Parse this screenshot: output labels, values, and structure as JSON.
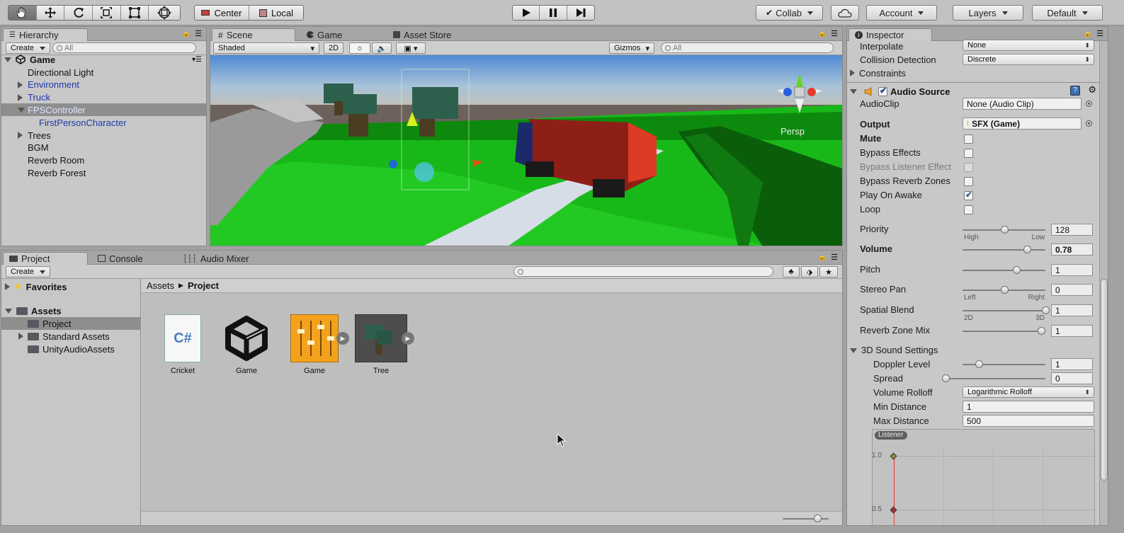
{
  "toolbar": {
    "center_label": "Center",
    "local_label": "Local",
    "collab_label": "Collab",
    "account_label": "Account",
    "layers_label": "Layers",
    "layout_label": "Default"
  },
  "hierarchy": {
    "tab": "Hierarchy",
    "create": "Create",
    "search_placeholder": "All",
    "scene": "Game",
    "items": [
      {
        "label": "Directional Light",
        "indent": 1,
        "expand": "",
        "style": "normal"
      },
      {
        "label": "Environment",
        "indent": 1,
        "expand": "collapsed",
        "style": "prefab"
      },
      {
        "label": "Truck",
        "indent": 1,
        "expand": "collapsed",
        "style": "prefab"
      },
      {
        "label": "FPSController",
        "indent": 1,
        "expand": "expanded",
        "style": "selected"
      },
      {
        "label": "FirstPersonCharacter",
        "indent": 2,
        "expand": "",
        "style": "prefab"
      },
      {
        "label": "Trees",
        "indent": 1,
        "expand": "collapsed",
        "style": "normal"
      },
      {
        "label": "BGM",
        "indent": 1,
        "expand": "",
        "style": "normal"
      },
      {
        "label": "Reverb Room",
        "indent": 1,
        "expand": "",
        "style": "normal"
      },
      {
        "label": "Reverb Forest",
        "indent": 1,
        "expand": "",
        "style": "normal"
      }
    ]
  },
  "scene_view": {
    "tabs": [
      "Scene",
      "Game",
      "Asset Store"
    ],
    "shading": "Shaded",
    "mode_2d": "2D",
    "gizmos": "Gizmos",
    "search_placeholder": "All",
    "persp": "Persp"
  },
  "project": {
    "tabs": [
      "Project",
      "Console",
      "Audio Mixer"
    ],
    "create": "Create",
    "tree": [
      {
        "label": "Favorites",
        "kind": "favorites",
        "indent": 0
      },
      {
        "label": "Assets",
        "kind": "folder-root",
        "indent": 0
      },
      {
        "label": "Project",
        "kind": "folder-selected",
        "indent": 1
      },
      {
        "label": "Standard Assets",
        "kind": "folder-collapsed",
        "indent": 1
      },
      {
        "label": "UnityAudioAssets",
        "kind": "folder",
        "indent": 1
      }
    ],
    "breadcrumb_root": "Assets",
    "breadcrumb_current": "Project",
    "assets": [
      {
        "label": "Cricket",
        "kind": "csharp-script",
        "icon_text": "C#"
      },
      {
        "label": "Game",
        "kind": "unity-scene"
      },
      {
        "label": "Game",
        "kind": "audio-mixer"
      },
      {
        "label": "Tree",
        "kind": "prefab"
      }
    ]
  },
  "inspector": {
    "tab": "Inspector",
    "interpolate": {
      "label": "Interpolate",
      "value": "None"
    },
    "collision": {
      "label": "Collision Detection",
      "value": "Discrete"
    },
    "constraints": "Constraints",
    "component": "Audio Source",
    "audioclip": {
      "label": "AudioClip",
      "value": "None (Audio Clip)"
    },
    "output": {
      "label": "Output",
      "value": "SFX (Game)"
    },
    "checks": [
      {
        "label": "Mute",
        "checked": false,
        "bold": true,
        "disabled": false
      },
      {
        "label": "Bypass Effects",
        "checked": false,
        "bold": false,
        "disabled": false
      },
      {
        "label": "Bypass Listener Effect",
        "checked": false,
        "bold": false,
        "disabled": true
      },
      {
        "label": "Bypass Reverb Zones",
        "checked": false,
        "bold": false,
        "disabled": false
      },
      {
        "label": "Play On Awake",
        "checked": true,
        "bold": false,
        "disabled": false
      },
      {
        "label": "Loop",
        "checked": false,
        "bold": false,
        "disabled": false
      }
    ],
    "sliders": [
      {
        "label": "Priority",
        "value": "128",
        "fraction": 0.5,
        "bold": false,
        "left": "High",
        "right": "Low"
      },
      {
        "label": "Volume",
        "value": "0.78",
        "fraction": 0.78,
        "bold": true,
        "left": "",
        "right": ""
      },
      {
        "label": "Pitch",
        "value": "1",
        "fraction": 0.65,
        "bold": false,
        "left": "",
        "right": ""
      },
      {
        "label": "Stereo Pan",
        "value": "0",
        "fraction": 0.5,
        "bold": false,
        "left": "Left",
        "right": "Right"
      },
      {
        "label": "Spatial Blend",
        "value": "1",
        "fraction": 1.0,
        "bold": false,
        "left": "2D",
        "right": "3D"
      },
      {
        "label": "Reverb Zone Mix",
        "value": "1",
        "fraction": 0.95,
        "bold": false,
        "left": "",
        "right": ""
      }
    ],
    "sound3d": "3D Sound Settings",
    "doppler": {
      "label": "Doppler Level",
      "value": "1",
      "fraction": 0.2
    },
    "spread": {
      "label": "Spread",
      "value": "0",
      "fraction": 0.0
    },
    "rolloff": {
      "label": "Volume Rolloff",
      "value": "Logarithmic Rolloff"
    },
    "min_distance": {
      "label": "Min Distance",
      "value": "1"
    },
    "max_distance": {
      "label": "Max Distance",
      "value": "500"
    },
    "graph": {
      "listener": "Listener",
      "y_top": "1.0",
      "y_mid": "0.5"
    }
  },
  "colors": {
    "panel": "#c8c8c8",
    "selected": "#8e8e8e",
    "prefab_text": "#1f3aa8",
    "audio_orange": "#f4a21d",
    "grass": "#1fc41f"
  }
}
